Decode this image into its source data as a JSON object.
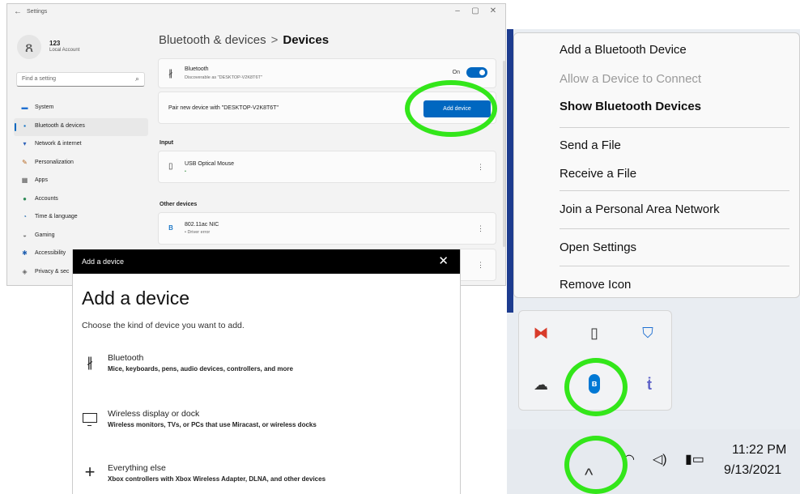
{
  "settings": {
    "window_title": "Settings",
    "account_name": "123",
    "account_type": "Local Account",
    "search_placeholder": "Find a setting",
    "nav": [
      {
        "label": "System",
        "icon": "monitor-icon",
        "color": "#1f6fd1",
        "glyph": "▬"
      },
      {
        "label": "Bluetooth & devices",
        "icon": "bluetooth-devices-icon",
        "color": "#0067c0",
        "glyph": "▪"
      },
      {
        "label": "Network & internet",
        "icon": "wifi-icon",
        "color": "#2b5fb8",
        "glyph": "▾"
      },
      {
        "label": "Personalization",
        "icon": "pencil-icon",
        "color": "#b5651d",
        "glyph": "✎"
      },
      {
        "label": "Apps",
        "icon": "apps-icon",
        "color": "#555555",
        "glyph": "▦"
      },
      {
        "label": "Accounts",
        "icon": "person-icon",
        "color": "#2e8b57",
        "glyph": "●"
      },
      {
        "label": "Time & language",
        "icon": "globe-clock-icon",
        "color": "#2a6fb0",
        "glyph": "◔"
      },
      {
        "label": "Gaming",
        "icon": "gamepad-icon",
        "color": "#777777",
        "glyph": "◒"
      },
      {
        "label": "Accessibility",
        "icon": "accessibility-icon",
        "color": "#1f5fb0",
        "glyph": "✱"
      },
      {
        "label": "Privacy & sec",
        "icon": "shield-icon",
        "color": "#666666",
        "glyph": "◈"
      }
    ],
    "breadcrumb_parent": "Bluetooth & devices",
    "breadcrumb_sep": ">",
    "breadcrumb_current": "Devices",
    "bluetooth_title": "Bluetooth",
    "bluetooth_sub": "Discoverable as \"DESKTOP-V2K8T6T\"",
    "toggle_label": "On",
    "pair_text": "Pair new device with \"DESKTOP-V2K8T6T\"",
    "add_device_button": "Add device",
    "input_section": "Input",
    "mouse_name": "USB Optical Mouse",
    "mouse_status": "•",
    "other_section": "Other devices",
    "nic_name": "802.11ac NIC",
    "nic_status": "• Driver error",
    "more_glyph": "⋮",
    "accent": "#0067c0"
  },
  "dialog": {
    "title": "Add a device",
    "close_glyph": "✕",
    "heading": "Add a device",
    "subtitle": "Choose the kind of device you want to add.",
    "options": [
      {
        "title": "Bluetooth",
        "desc": "Mice, keyboards, pens, audio devices, controllers, and more",
        "icon": "bluetooth-icon"
      },
      {
        "title": "Wireless display or dock",
        "desc": "Wireless monitors, TVs, or PCs that use Miracast, or wireless docks",
        "icon": "monitor-icon"
      },
      {
        "title": "Everything else",
        "desc": "Xbox controllers with Xbox Wireless Adapter, DLNA, and other devices",
        "icon": "plus-icon"
      }
    ]
  },
  "context_menu": {
    "items": [
      {
        "label": "Add a Bluetooth Device",
        "state": "normal"
      },
      {
        "label": "Allow a Device to Connect",
        "state": "disabled"
      },
      {
        "label": "Show Bluetooth Devices",
        "state": "bold"
      },
      {
        "label": "Send a File",
        "state": "normal"
      },
      {
        "label": "Receive a File",
        "state": "normal"
      },
      {
        "label": "Join a Personal Area Network",
        "state": "normal"
      },
      {
        "label": "Open Settings",
        "state": "normal"
      },
      {
        "label": "Remove Icon",
        "state": "normal"
      }
    ]
  },
  "tray": {
    "icons": [
      "app-icon",
      "usb-drive-icon",
      "security-warning-icon",
      "onedrive-offline-icon",
      "bluetooth-icon",
      "teams-icon"
    ],
    "bluetooth_glyph": "ʙ"
  },
  "taskbar": {
    "chevron": "^",
    "time": "11:22 PM",
    "date": "9/13/2021"
  },
  "highlight_color": "#33e61a"
}
